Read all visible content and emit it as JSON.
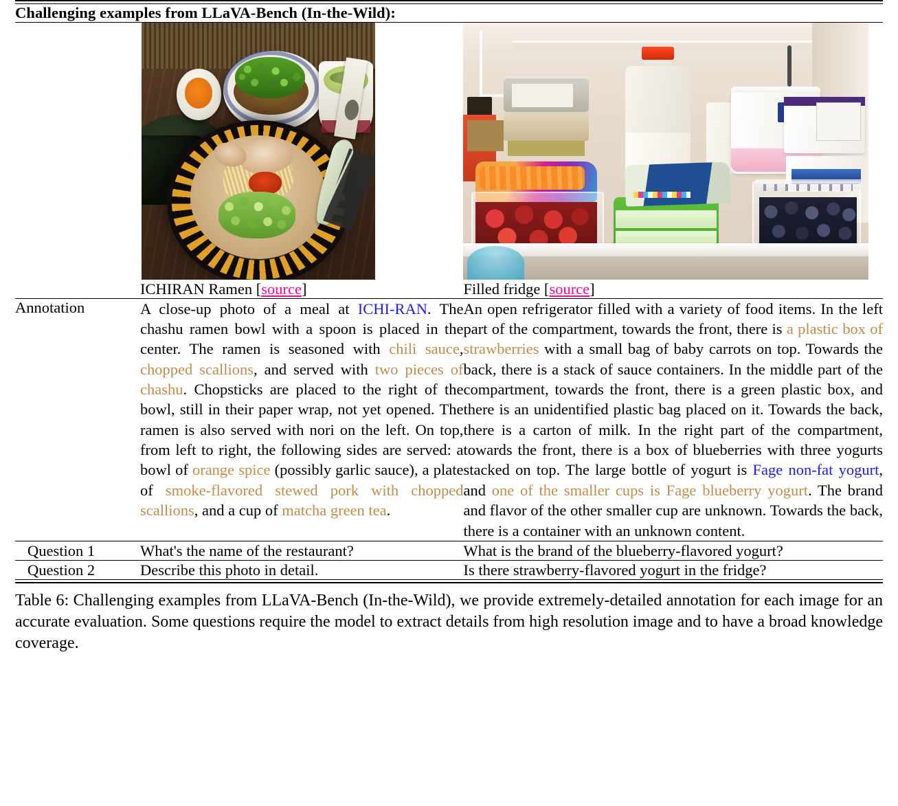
{
  "header": {
    "title": "Challenging examples from LLaVA-Bench (In-the-Wild):"
  },
  "columns": [
    {
      "caption_text": "ICHIRAN Ramen [",
      "caption_source": "source",
      "caption_close": "]",
      "photo_name": "ramen-photo"
    },
    {
      "caption_text": "Filled fridge [",
      "caption_source": "source",
      "caption_close": "]",
      "photo_name": "fridge-photo"
    }
  ],
  "rows": {
    "annotation": {
      "label": "Annotation",
      "left_segments": [
        {
          "text": "A close-up photo of a meal at ",
          "style": "plain"
        },
        {
          "text": "ICHI-RAN",
          "style": "link"
        },
        {
          "text": ". The chashu ramen bowl with a spoon is placed in the center. The ramen is seasoned with ",
          "style": "plain"
        },
        {
          "text": "chili sauce",
          "style": "highlight"
        },
        {
          "text": ", ",
          "style": "plain"
        },
        {
          "text": "chopped scallions",
          "style": "highlight"
        },
        {
          "text": ", and served with ",
          "style": "plain"
        },
        {
          "text": "two pieces of chashu",
          "style": "highlight"
        },
        {
          "text": ". Chopsticks are placed to the right of the bowl, still in their paper wrap, not yet opened. The ramen is also served with nori on the left. On top, from left to right, the following sides are served: a bowl of ",
          "style": "plain"
        },
        {
          "text": "orange spice",
          "style": "highlight"
        },
        {
          "text": " (possibly garlic sauce), a plate of ",
          "style": "plain"
        },
        {
          "text": "smoke-flavored stewed pork with chopped scallions",
          "style": "highlight"
        },
        {
          "text": ", and a cup of ",
          "style": "plain"
        },
        {
          "text": "matcha green tea",
          "style": "highlight"
        },
        {
          "text": ".",
          "style": "plain"
        }
      ],
      "right_segments": [
        {
          "text": "An open refrigerator filled with a variety of food items. In the left part of the compartment, towards the front, there is ",
          "style": "plain"
        },
        {
          "text": "a plastic box of strawberries",
          "style": "highlight"
        },
        {
          "text": " with a small bag of baby carrots on top. Towards the back, there is a stack of sauce containers. In the middle part of the compartment, towards the front, there is a green plastic box, and there is an unidentified plastic bag placed on it. Towards the back, there is a carton of milk. In the right part of the compartment, towards the front, there is a box of blueberries with three yogurts stacked on top. The large bottle of yogurt is ",
          "style": "plain"
        },
        {
          "text": "Fage non-fat yogurt",
          "style": "link"
        },
        {
          "text": ", and ",
          "style": "plain"
        },
        {
          "text": "one of the smaller cups is Fage blueberry yogurt",
          "style": "highlight"
        },
        {
          "text": ". The brand and flavor of the other smaller cup are unknown. Towards the back, there is a container with an unknown content.",
          "style": "plain"
        }
      ]
    },
    "question1": {
      "label": "Question 1",
      "left": "What's the name of the restaurant?",
      "right": "What is the brand of the blueberry-flavored yogurt?"
    },
    "question2": {
      "label": "Question 2",
      "left": "Describe this photo in detail.",
      "right": "Is there strawberry-flavored yogurt in the fridge?"
    }
  },
  "table_caption": {
    "label": "Table 6:",
    "text": " Challenging examples from LLaVA-Bench (In-the-Wild), we provide extremely-detailed annotation for each image for an accurate evaluation. Some questions require the model to extract details from high resolution image and to have a broad knowledge coverage."
  },
  "colors": {
    "source_link": "#ff00a0",
    "entity_link": "#1a1aff",
    "highlight": "#c58a48",
    "text": "#000000",
    "background": "#ffffff"
  }
}
